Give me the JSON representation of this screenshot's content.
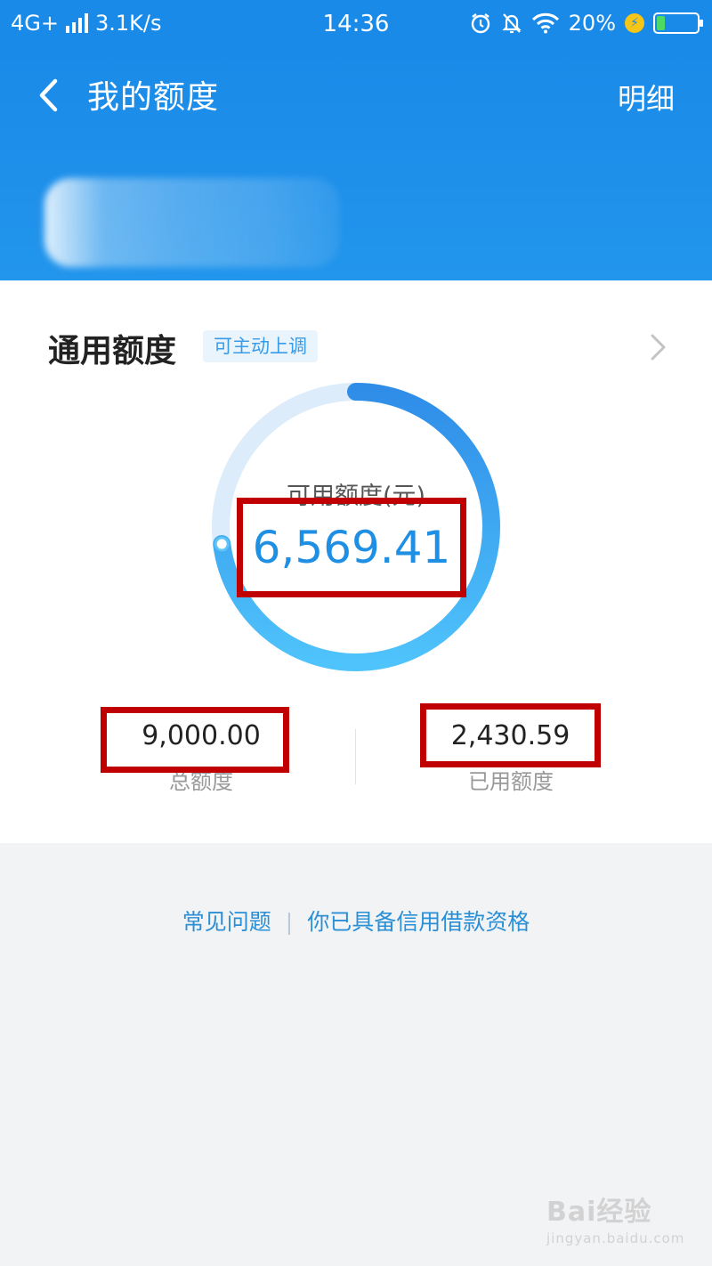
{
  "status_bar": {
    "network": "4G+",
    "speed": "3.1K/s",
    "time": "14:36",
    "battery": "20%",
    "battery_level": 0.2
  },
  "header": {
    "title": "我的额度",
    "detail_link": "明细"
  },
  "credit": {
    "section_title": "通用额度",
    "adjust_tag": "可主动上调",
    "available_label": "可用额度(元)",
    "available_value": "6,569.41",
    "total_value": "9,000.00",
    "total_label": "总额度",
    "used_value": "2,430.59",
    "used_label": "已用额度",
    "available_fraction": 0.73
  },
  "footer": {
    "faq_link": "常见问题",
    "separator": "|",
    "qualification_link": "你已具备信用借款资格"
  },
  "watermark": {
    "text": "Bai经验",
    "sub": "jingyan.baidu.com"
  },
  "colors": {
    "primary": "#1a8ae8",
    "highlight_box": "#c00000",
    "link": "#2b8fd6"
  }
}
